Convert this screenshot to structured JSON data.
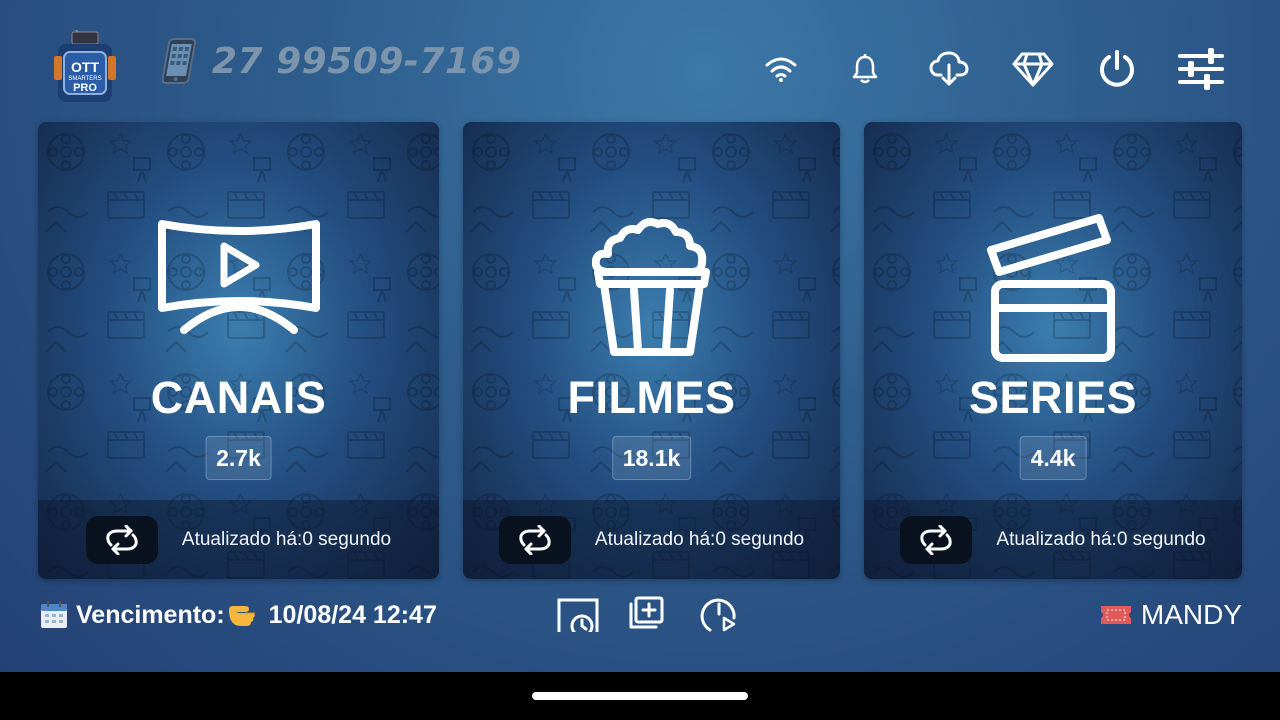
{
  "header": {
    "logo_text": "OTT SMARTERS PRO",
    "phone_number": "27 99509-7169",
    "icons": [
      "wifi-icon",
      "bell-icon",
      "cloud-download-icon",
      "diamond-icon",
      "power-icon",
      "sliders-icon"
    ]
  },
  "cards": [
    {
      "title": "CANAIS",
      "count": "2.7k",
      "updated": "Atualizado há:0 segundo",
      "icon": "curved-tv-play-icon"
    },
    {
      "title": "FILMES",
      "count": "18.1k",
      "updated": "Atualizado há:0 segundo",
      "icon": "popcorn-icon"
    },
    {
      "title": "SERIES",
      "count": "4.4k",
      "updated": "Atualizado há:0 segundo",
      "icon": "clapperboard-icon"
    }
  ],
  "footer": {
    "expiry_label": "Vencimento:",
    "expiry_value": "10/08/24 12:47",
    "user_name": "MANDY",
    "center_icons": [
      "catch-up-icon",
      "add-playlist-icon",
      "recent-play-icon"
    ]
  },
  "colors": {
    "phone_text": "#7d94ad",
    "ticket_red": "#e05a5a",
    "card_footer": "#0c162a"
  }
}
